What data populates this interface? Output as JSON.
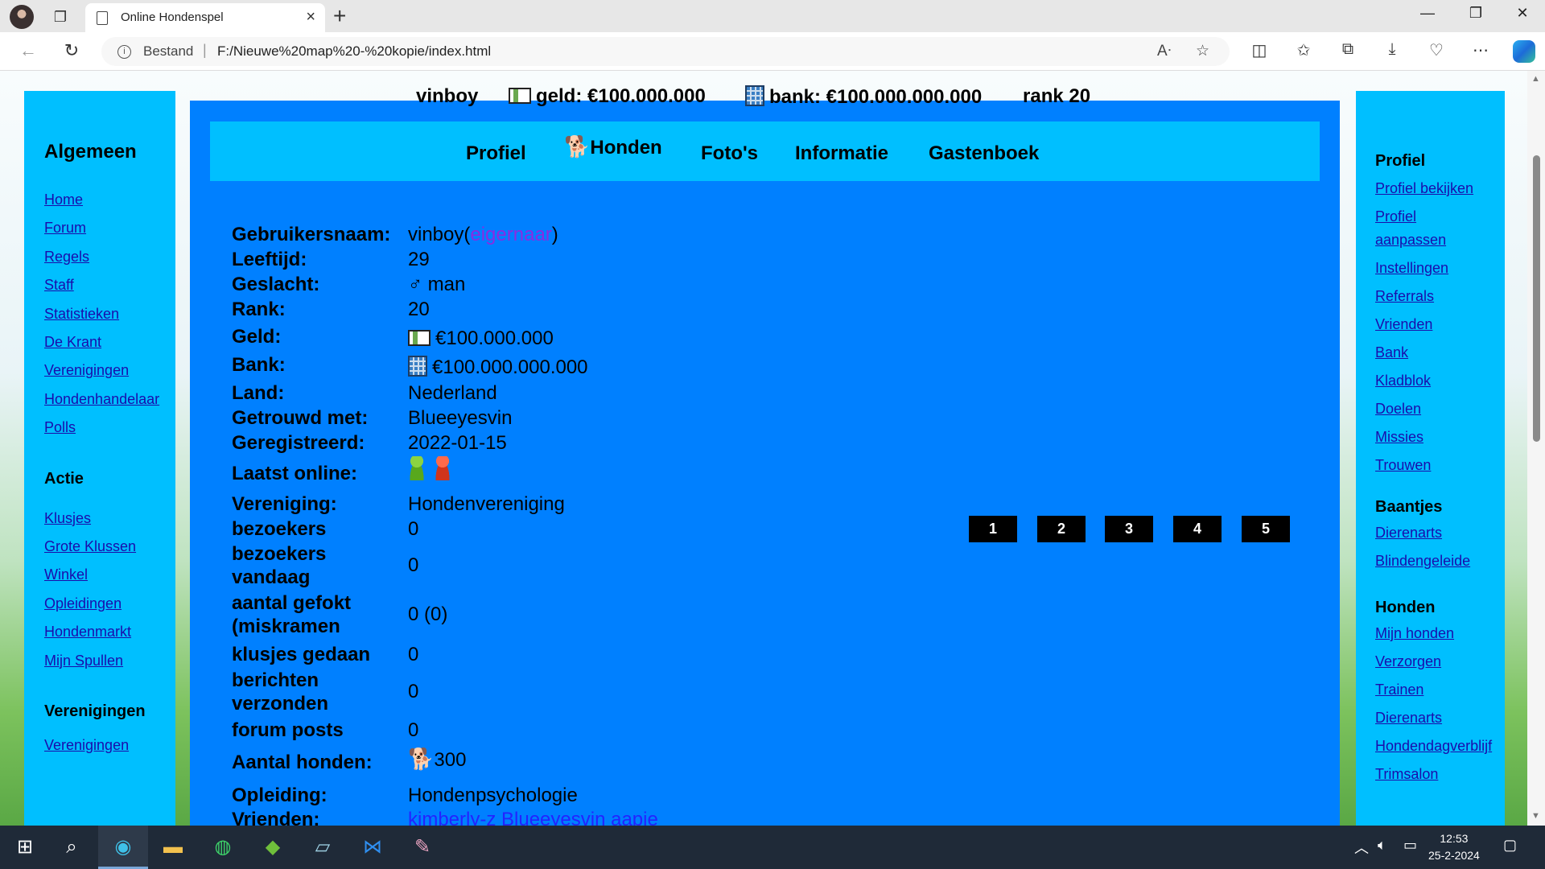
{
  "browser": {
    "tab_title": "Online Hondenspel",
    "address_prefix": "Bestand",
    "address_separator": "|",
    "url": "F:/Nieuwe%20map%20-%20kopie/index.html"
  },
  "top_stats": {
    "username": "vinboy",
    "geld": "geld: €100.000.000",
    "bank": "bank: €100.000.000.000",
    "rank": "rank 20"
  },
  "profile_nav": {
    "items": [
      "Profiel",
      "Honden",
      "Foto's",
      "Informatie",
      "Gastenboek"
    ]
  },
  "left_sidebar": {
    "sections": [
      {
        "title": "Algemeen",
        "links": [
          "Home",
          "Forum",
          "Regels",
          "Staff",
          "Statistieken",
          "De Krant",
          "Verenigingen",
          "Hondenhandelaar",
          "Polls"
        ]
      },
      {
        "title": "Actie",
        "links": [
          "Klusjes",
          "Grote Klussen",
          "Winkel",
          "Opleidingen",
          "Hondenmarkt",
          "Mijn Spullen"
        ]
      },
      {
        "title": "Verenigingen",
        "links": [
          "Verenigingen"
        ]
      }
    ]
  },
  "right_sidebar": {
    "sections": [
      {
        "title": "Profiel",
        "links": [
          "Profiel bekijken",
          "Profiel aanpassen",
          "Instellingen",
          "Referrals",
          "Vrienden",
          "Bank",
          "Kladblok",
          "Doelen",
          "Missies",
          "Trouwen"
        ]
      },
      {
        "title": "Baantjes",
        "links": [
          "Dierenarts",
          "Blindengeleide"
        ]
      },
      {
        "title": "Honden",
        "links": [
          "Mijn honden",
          "Verzorgen",
          "Trainen",
          "Dierenarts",
          "Hondendagverblijf",
          "Trimsalon"
        ]
      }
    ]
  },
  "profile": {
    "gebruikersnaam_label": "Gebruikersnaam:",
    "gebruikersnaam_value": "vinboy",
    "gebruikersnaam_paren_open": "(",
    "gebruikersnaam_role": "eigernaar",
    "gebruikersnaam_paren_close": ")",
    "leeftijd_label": "Leeftijd:",
    "leeftijd_value": "29",
    "geslacht_label": "Geslacht:",
    "geslacht_value": "♂ man",
    "rank_label": "Rank:",
    "rank_value": "20",
    "geld_label": "Geld:",
    "geld_value": "€100.000.000",
    "bank_label": "Bank:",
    "bank_value": "€100.000.000.000",
    "land_label": "Land:",
    "land_value": "Nederland",
    "getrouwd_label": "Getrouwd met:",
    "getrouwd_value": "Blueeyesvin",
    "geregistreerd_label": "Geregistreerd:",
    "geregistreerd_value": "2022-01-15",
    "laatst_online_label": "Laatst online:",
    "vereniging_label": "Vereniging:",
    "vereniging_value": "Hondenvereniging",
    "bezoekers_label": "bezoekers",
    "bezoekers_value": "0",
    "bezoekers_vandaag_label_1": "bezoekers",
    "bezoekers_vandaag_label_2": "vandaag",
    "bezoekers_vandaag_value": "0",
    "gefokt_label_1": "aantal gefokt",
    "gefokt_label_2": "(miskramen",
    "gefokt_value": "0 (0)",
    "klusjes_label": "klusjes gedaan",
    "klusjes_value": "0",
    "berichten_label_1": "berichten",
    "berichten_label_2": "verzonden",
    "berichten_value": "0",
    "forum_label": "forum posts",
    "forum_value": "0",
    "honden_label": "Aantal honden:",
    "honden_value": "300",
    "opleiding_label": "Opleiding:",
    "opleiding_value": "Hondenpsychologie",
    "vrienden_label": "Vrienden:",
    "vrienden_links": [
      "kimberly-z",
      "Blueeyesvin",
      "aapje"
    ]
  },
  "pager": [
    "1",
    "2",
    "3",
    "4",
    "5"
  ],
  "taskbar": {
    "time": "12:53",
    "date": "25-2-2024"
  },
  "colors": {
    "sidebar_bg": "#00bfff",
    "main_bg": "#0080ff",
    "link": "#1a0dab",
    "role": "#8a2be2"
  }
}
